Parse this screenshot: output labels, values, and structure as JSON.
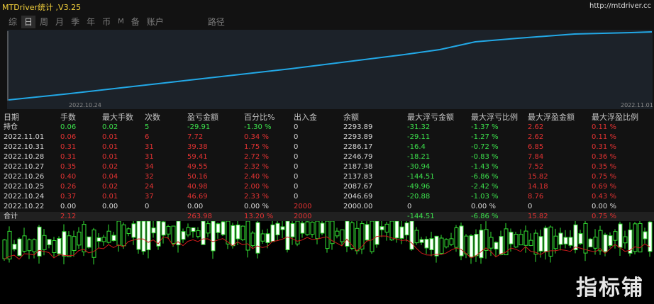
{
  "app": {
    "title": "MTDriver统计 ,V3.25",
    "site": "http://mtdriver.cc"
  },
  "tabs": [
    "综",
    "日",
    "周",
    "月",
    "季",
    "年",
    "币",
    "M",
    "备",
    "账户",
    "路径"
  ],
  "active_tab": "日",
  "chart": {
    "date_start": "2022.10.24",
    "date_end": "2022.11.01",
    "line_color": "#22a8e6"
  },
  "table": {
    "headers": [
      "日期",
      "手数",
      "最大手数",
      "次数",
      "盈亏金额",
      "百分比%",
      "出入金",
      "余额",
      "最大浮亏金额",
      "最大浮亏比例",
      "最大浮盈金额",
      "最大浮盈比例"
    ],
    "rows": [
      [
        "持仓",
        "0.06",
        "0.02",
        "5",
        "-29.91",
        "-1.30 %",
        "0",
        "2293.89",
        "-31.32",
        "-1.37 %",
        "2.62",
        "0.11 %"
      ],
      [
        "2022.11.01",
        "0.06",
        "0.01",
        "6",
        "7.72",
        "0.34 %",
        "0",
        "2293.89",
        "-29.11",
        "-1.27 %",
        "2.62",
        "0.11 %"
      ],
      [
        "2022.10.31",
        "0.31",
        "0.01",
        "31",
        "39.38",
        "1.75 %",
        "0",
        "2286.17",
        "-16.4",
        "-0.72 %",
        "6.85",
        "0.31 %"
      ],
      [
        "2022.10.28",
        "0.31",
        "0.01",
        "31",
        "59.41",
        "2.72 %",
        "0",
        "2246.79",
        "-18.21",
        "-0.83 %",
        "7.84",
        "0.36 %"
      ],
      [
        "2022.10.27",
        "0.35",
        "0.02",
        "34",
        "49.55",
        "2.32 %",
        "0",
        "2187.38",
        "-30.94",
        "-1.43 %",
        "7.52",
        "0.35 %"
      ],
      [
        "2022.10.26",
        "0.40",
        "0.04",
        "32",
        "50.16",
        "2.40 %",
        "0",
        "2137.83",
        "-144.51",
        "-6.86 %",
        "15.82",
        "0.75 %"
      ],
      [
        "2022.10.25",
        "0.26",
        "0.02",
        "24",
        "40.98",
        "2.00 %",
        "0",
        "2087.67",
        "-49.96",
        "-2.42 %",
        "14.18",
        "0.69 %"
      ],
      [
        "2022.10.24",
        "0.37",
        "0.01",
        "37",
        "46.69",
        "2.33 %",
        "0",
        "2046.69",
        "-20.88",
        "-1.03 %",
        "8.76",
        "0.43 %"
      ],
      [
        "2022.10.22",
        "0.00",
        "0.00",
        "0",
        "0.00",
        "0.00 %",
        "2000",
        "2000.00",
        "0",
        "0.00 %",
        "0",
        "0.00 %"
      ]
    ],
    "total": [
      "合计",
      "2.12",
      "",
      "",
      "263.98",
      "13.20 %",
      "2000",
      "",
      "-144.51",
      "-6.86 %",
      "15.82",
      "0.75 %"
    ]
  },
  "watermark": "指标铺"
}
